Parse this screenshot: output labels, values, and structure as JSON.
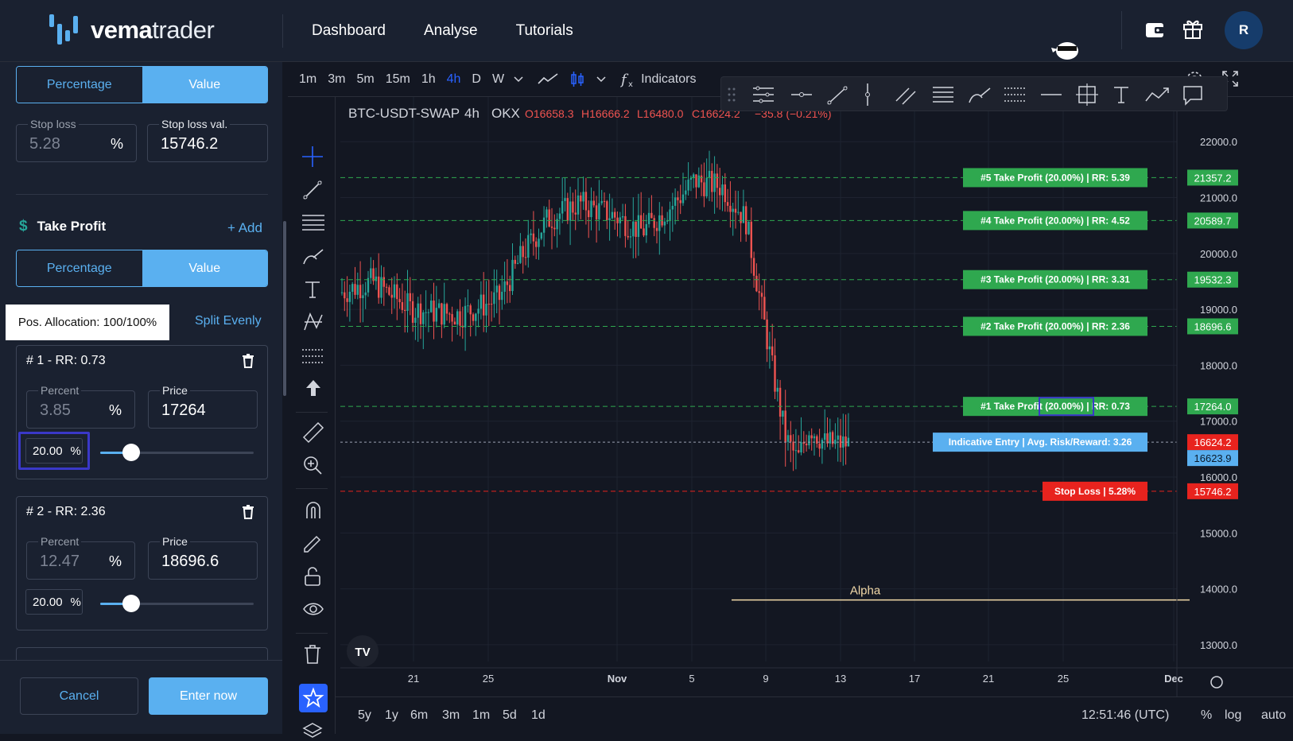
{
  "nav": {
    "brand_bold": "vema",
    "brand_light": "trader",
    "links": [
      "Dashboard",
      "Analyse",
      "Tutorials"
    ],
    "avatar": "R"
  },
  "sidebar": {
    "sl_mode": {
      "left": "Percentage",
      "right": "Value",
      "active": "Value"
    },
    "stop_loss": {
      "label": "Stop loss",
      "value": "5.28",
      "unit": "%"
    },
    "stop_loss_val": {
      "label": "Stop loss val.",
      "value": "15746.2"
    },
    "take_profit": {
      "title": "Take Profit",
      "add": "+ Add"
    },
    "tp_mode": {
      "left": "Percentage",
      "right": "Value",
      "active": "Value"
    },
    "allocation": "Pos. Allocation: 100/100%",
    "split_evenly": "Split Evenly",
    "targets": [
      {
        "title": "# 1 - RR: 0.73",
        "percent_label": "Percent",
        "percent": "3.85",
        "unit": "%",
        "price_label": "Price",
        "price": "17264",
        "alloc": "20.00",
        "alloc_unit": "%",
        "slider_fraction": 0.2
      },
      {
        "title": "# 2 - RR: 2.36",
        "percent_label": "Percent",
        "percent": "12.47",
        "unit": "%",
        "price_label": "Price",
        "price": "18696.6",
        "alloc": "20.00",
        "alloc_unit": "%",
        "slider_fraction": 0.2
      }
    ],
    "cancel": "Cancel",
    "enter": "Enter now"
  },
  "chart_toolbar": {
    "timeframes": [
      "1m",
      "3m",
      "5m",
      "15m",
      "1h",
      "4h",
      "D",
      "W"
    ],
    "active": "4h",
    "indicators": "Indicators"
  },
  "chart_data": {
    "type": "candlestick",
    "symbol": "BTC-USDT-SWAP",
    "interval": "4h",
    "exchange": "OKX",
    "ohlc": {
      "o": "O16658.3",
      "h": "H16666.2",
      "l": "L16480.0",
      "c": "C16624.2",
      "chg": "−35.8 (−0.21%)"
    },
    "ylim": [
      12700,
      22800
    ],
    "y_ticks": [
      22000,
      21000,
      20000,
      19000,
      18000,
      17000,
      16000,
      15000,
      14000,
      13000
    ],
    "x_ticks": [
      "21",
      "25",
      "Nov",
      "5",
      "9",
      "13",
      "17",
      "21",
      "25",
      "Dec"
    ],
    "levels": [
      {
        "label": "#5 Take Profit (20.00%) | RR: 5.39",
        "price": 21357.2,
        "tag": "21357.2",
        "color": "#2fa84f"
      },
      {
        "label": "#4 Take Profit (20.00%) | RR: 4.52",
        "price": 20589.7,
        "tag": "20589.7",
        "color": "#2fa84f"
      },
      {
        "label": "#3 Take Profit (20.00%) | RR: 3.31",
        "price": 19532.3,
        "tag": "19532.3",
        "color": "#2fa84f"
      },
      {
        "label": "#2 Take Profit (20.00%) | RR: 2.36",
        "price": 18696.6,
        "tag": "18696.6",
        "color": "#2fa84f"
      },
      {
        "label": "#1 Take Profit (20.00%) | RR: 0.73",
        "price": 17264.0,
        "tag": "17264.0",
        "color": "#2fa84f"
      },
      {
        "label": "Indicative Entry | Avg. Risk/Reward: 3.26",
        "price": 16624.2,
        "tag": "16624.2",
        "color": "#5ab0f0"
      },
      {
        "label": "Stop Loss | 5.28%",
        "price": 15746.2,
        "tag": "15746.2",
        "color": "#e8231e"
      }
    ],
    "extra_tag": "16623.9",
    "alpha_label": "Alpha",
    "alpha_price": 13800
  },
  "bottom": {
    "ranges": [
      "5y",
      "1y",
      "6m",
      "3m",
      "1m",
      "5d",
      "1d"
    ],
    "time": "12:51:46 (UTC)",
    "pct": "%",
    "log": "log",
    "auto": "auto"
  }
}
